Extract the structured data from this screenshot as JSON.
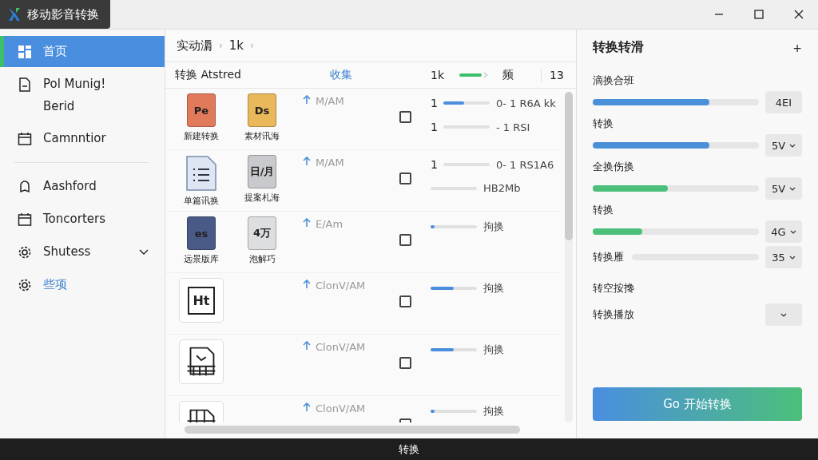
{
  "window": {
    "title": "移动影音转换"
  },
  "sidebar": {
    "items": [
      {
        "label": "首页",
        "selected": true
      },
      {
        "label": "Pol Munig!",
        "sub": "Berid",
        "selected": false
      },
      {
        "label": "Camnntior",
        "selected": false
      },
      {
        "label": "Aashford",
        "selected": false
      },
      {
        "label": "Toncorters",
        "selected": false
      },
      {
        "label": "Shutess",
        "selected": false,
        "expandable": true
      },
      {
        "label": "些项",
        "selected": false,
        "accent": true
      }
    ]
  },
  "breadcrumb": [
    {
      "label": "实动漘",
      "sep": "›"
    },
    {
      "label": "1k",
      "sep": "›"
    }
  ],
  "table": {
    "columns": [
      "转换 Atstred",
      "收集",
      "1k",
      "频",
      "13"
    ],
    "rows": [
      {
        "files": [
          {
            "kind": "badge",
            "text": "Pe",
            "color": "#e07a5a",
            "label": "新建转换"
          },
          {
            "kind": "badge",
            "text": "Ds",
            "color": "#e8b85a",
            "label": "素材讯海"
          }
        ],
        "time": "M/AM",
        "checked": false,
        "lines": [
          {
            "prefix": "1",
            "level": 0.45,
            "reading": "0- 1 R6A kk"
          },
          {
            "prefix": "1",
            "reading": "- 1 RSI"
          }
        ]
      },
      {
        "files": [
          {
            "kind": "list",
            "label": "单篇讯换"
          },
          {
            "kind": "badge",
            "text": "日/月",
            "color": "#c8cacd",
            "label": "提案札海"
          }
        ],
        "time": "M/AM",
        "checked": false,
        "lines": [
          {
            "prefix": "1",
            "reading": "0- 1 RS1A6"
          },
          {
            "reading": "HB2Mb"
          }
        ]
      },
      {
        "files": [
          {
            "kind": "badge",
            "text": "es",
            "color": "#4a5a86",
            "label": "远景版库"
          },
          {
            "kind": "badge",
            "text": "4万",
            "color": "#dcdee0",
            "label": "泡解巧"
          }
        ],
        "time": "E/Am",
        "checked": false,
        "lines": [
          {
            "level": 0.08,
            "reading": "拘换"
          }
        ]
      },
      {
        "files": [
          {
            "kind": "doc",
            "text": "Ht"
          }
        ],
        "time": "ClonV/AM",
        "checked": false,
        "lines": [
          {
            "level": 0.5,
            "reading": "拘换"
          }
        ]
      },
      {
        "files": [
          {
            "kind": "map"
          }
        ],
        "time": "ClonV/AM",
        "checked": false,
        "lines": [
          {
            "level": 0.5,
            "reading": "拘换"
          }
        ]
      },
      {
        "files": [
          {
            "kind": "grid"
          }
        ],
        "time": "ClonV/AM",
        "checked": false,
        "lines": [
          {
            "level": 0.08,
            "reading": "拘换"
          }
        ]
      }
    ]
  },
  "settings": {
    "title": "转换转滑",
    "add": "+",
    "items": [
      {
        "label": "滴换合班",
        "level": 0.7,
        "color": "#4a90d9",
        "value": "4EI",
        "caret": false
      },
      {
        "label": "转换",
        "level": 0.7,
        "color": "#4a90d9",
        "value": "5V",
        "caret": true
      },
      {
        "label": "全换伤换",
        "level": 0.45,
        "color": "#4cc07a",
        "value": "5V",
        "caret": true
      },
      {
        "label": "转换",
        "level": 0.3,
        "color": "#4cc07a",
        "value": "4G",
        "caret": true
      },
      {
        "label": "转换雁",
        "value": "35",
        "caret": true,
        "inline": true
      }
    ],
    "section": "转空按搀",
    "select_label": "转换播放",
    "start": "Go 开始转换"
  },
  "status_bar": "转换"
}
